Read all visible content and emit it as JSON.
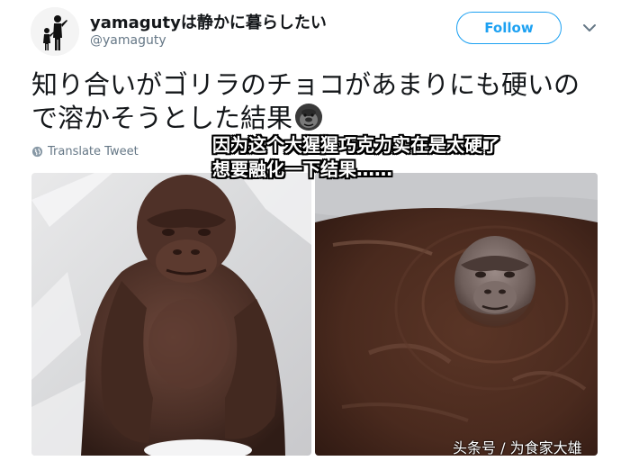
{
  "tweet": {
    "display_name": "yamagutyは静かに暮らしたい",
    "handle": "@yamaguty",
    "follow_label": "Follow",
    "text": "知り合いがゴリラのチョコがあまりにも硬いので溶かそうとした結果",
    "translate_label": "Translate Tweet"
  },
  "overlay_caption": {
    "line1": "因为这个大猩猩巧克力实在是太硬了",
    "line2": "想要融化一下结果……"
  },
  "watermark": "头条号 / 为食家大雄",
  "icons": {
    "avatar": "silhouette-avatar",
    "chevron": "chevron-down-icon",
    "globe": "globe-icon",
    "emoji": "gorilla-emoji"
  },
  "colors": {
    "accent": "#1da1f2",
    "secondary_text": "#657786",
    "chocolate": "#4a2e24"
  }
}
